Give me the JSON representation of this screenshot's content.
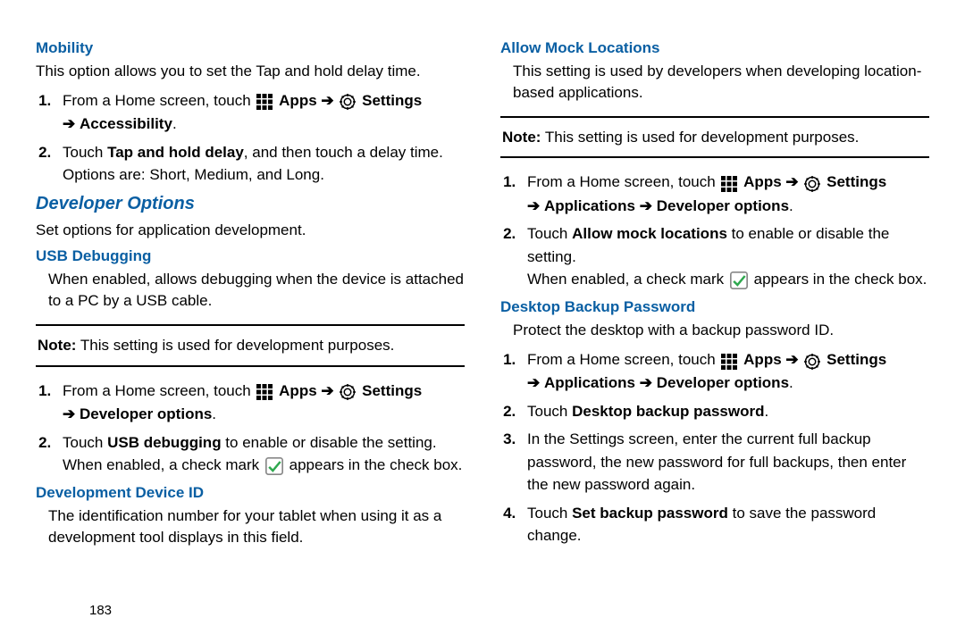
{
  "left": {
    "mobility": {
      "title": "Mobility",
      "intro": "This option allows you to set the Tap and hold delay time.",
      "step1_pre": "From a Home screen, touch ",
      "apps": "Apps",
      "settings": "Settings",
      "accessibility": "Accessibility",
      "step2_pre": "Touch ",
      "step2_bold": "Tap and hold delay",
      "step2_post": ", and then touch a delay time. Options are: Short, Medium, and Long."
    },
    "devopt": {
      "title": "Developer Options",
      "intro": "Set options for application development."
    },
    "usb": {
      "title": "USB Debugging",
      "intro": "When enabled, allows debugging when the device is attached to a PC by a USB cable.",
      "note_label": "Note:",
      "note_text": " This setting is used for development purposes.",
      "step1_pre": "From a Home screen, touch ",
      "apps": "Apps",
      "settings": "Settings",
      "devoptions": "Developer options",
      "step2_pre": "Touch ",
      "step2_bold": "USB debugging",
      "step2_post1": " to enable or disable the setting. When enabled, a check mark ",
      "step2_post2": " appears in the check box."
    },
    "devid": {
      "title": "Development Device ID",
      "body": "The identification number for your tablet when using it as a development tool displays in this field."
    }
  },
  "right": {
    "mock": {
      "title": "Allow Mock Locations",
      "intro": "This setting is used by developers when developing location-based applications.",
      "note_label": "Note:",
      "note_text": " This setting is used for development purposes.",
      "step1_pre": "From a Home screen, touch ",
      "apps": "Apps",
      "settings": "Settings",
      "applications": "Applications",
      "devoptions": "Developer options",
      "step2_pre": "Touch ",
      "step2_bold": "Allow mock locations",
      "step2_post": " to enable or disable the setting.",
      "step2_line2a": "When enabled, a check mark ",
      "step2_line2b": " appears in the check box."
    },
    "desktop": {
      "title": "Desktop Backup Password",
      "intro": "Protect the desktop with a backup password ID.",
      "step1_pre": "From a Home screen, touch ",
      "apps": "Apps",
      "settings": "Settings",
      "applications": "Applications",
      "devoptions": "Developer options",
      "step2_pre": "Touch ",
      "step2_bold": "Desktop backup password",
      "step2_post": ".",
      "step3": "In the Settings screen, enter the current full backup password, the new password for full backups, then enter the new password again.",
      "step4_pre": "Touch ",
      "step4_bold": "Set backup password",
      "step4_post": " to save the password change."
    }
  },
  "icons": {
    "arrow": "➔"
  },
  "page_number": "183"
}
